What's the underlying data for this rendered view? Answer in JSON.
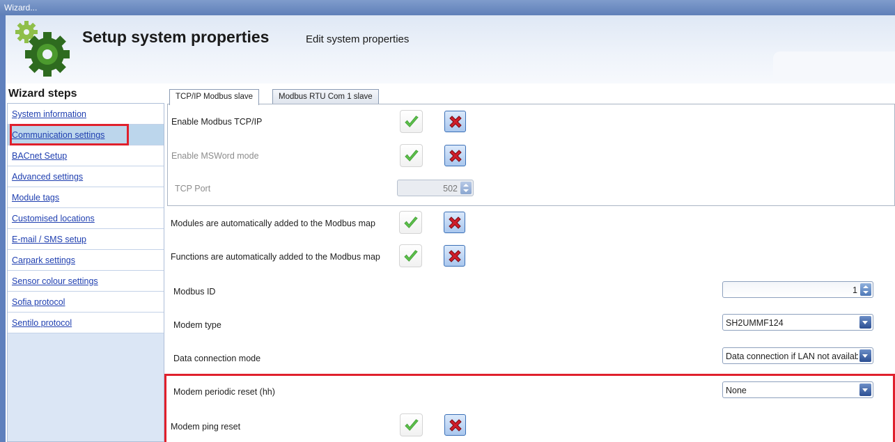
{
  "window": {
    "title": "Wizard..."
  },
  "header": {
    "title": "Setup system properties",
    "subtitle": "Edit system properties",
    "logo_icon": "gears-icon"
  },
  "steps": {
    "title": "Wizard steps",
    "items": [
      {
        "label": "System information"
      },
      {
        "label": "Communication settings",
        "selected": true
      },
      {
        "label": "BACnet Setup"
      },
      {
        "label": "Advanced settings"
      },
      {
        "label": "Module tags"
      },
      {
        "label": "Customised locations"
      },
      {
        "label": "E-mail / SMS setup"
      },
      {
        "label": "Carpark settings"
      },
      {
        "label": "Sensor colour settings"
      },
      {
        "label": "Sofia protocol"
      },
      {
        "label": "Sentilo protocol"
      }
    ]
  },
  "tabs": [
    {
      "label": "TCP/IP Modbus slave",
      "active": true
    },
    {
      "label": "Modbus RTU Com 1 slave",
      "active": false
    }
  ],
  "tcp": {
    "enable_modbus_label": "Enable Modbus TCP/IP",
    "enable_msword_label": "Enable MSWord mode",
    "tcp_port_label": "TCP Port",
    "tcp_port_value": "502"
  },
  "form": {
    "modules_label": "Modules are automatically added to the Modbus map",
    "functions_label": "Functions are automatically added to the Modbus map",
    "modbus_id_label": "Modbus ID",
    "modbus_id_value": "1",
    "modem_type_label": "Modem type",
    "modem_type_value": "SH2UMMF124",
    "data_conn_label": "Data connection mode",
    "data_conn_value": "Data connection if LAN not available",
    "modem_reset_label": "Modem periodic reset (hh)",
    "modem_reset_value": "None",
    "ping_reset_label": "Modem ping reset"
  },
  "colors": {
    "highlight": "#e0202c",
    "check": "#5cbf4a",
    "cross": "#d01d2a",
    "link": "#1f3fb0"
  }
}
